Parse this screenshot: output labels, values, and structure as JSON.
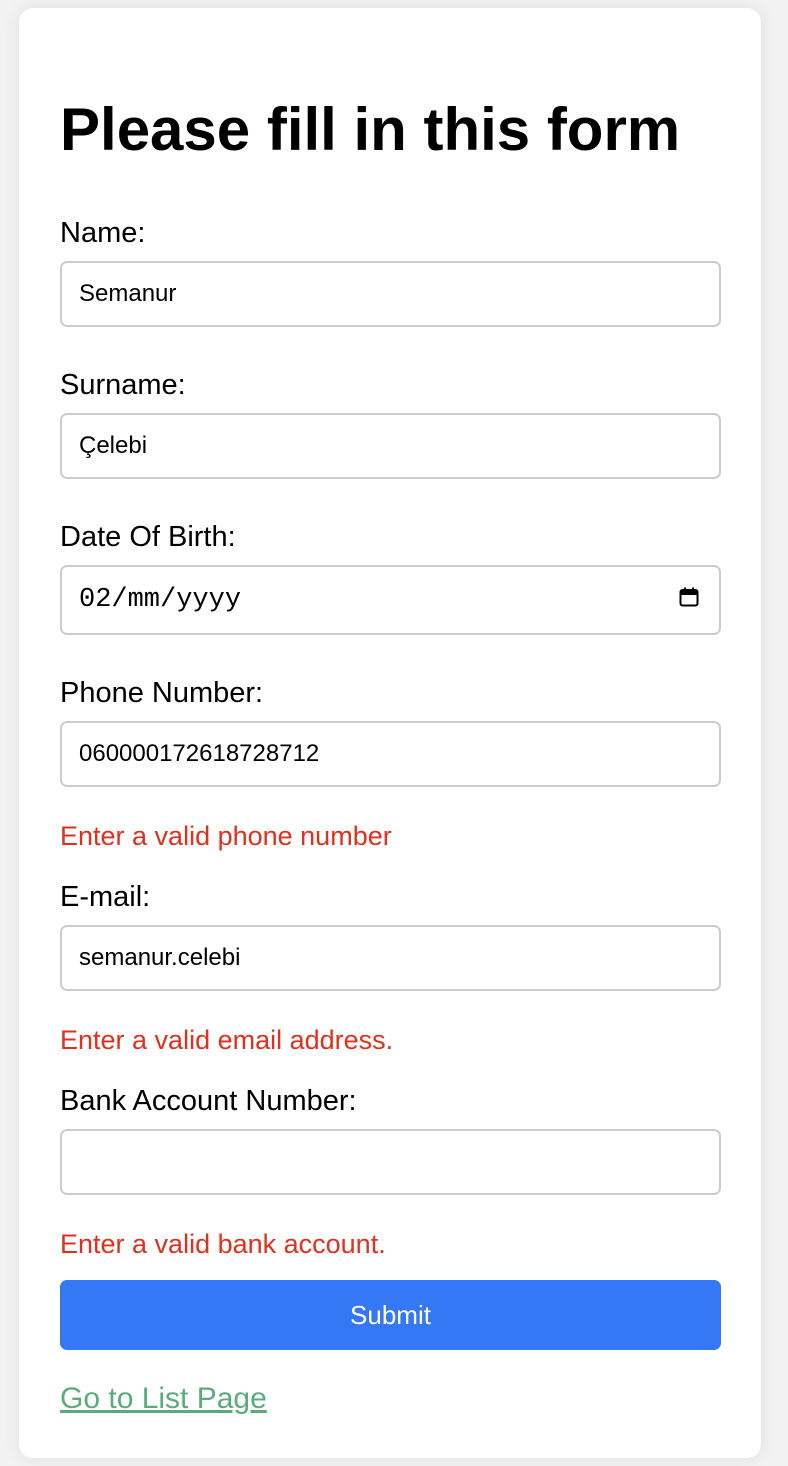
{
  "form": {
    "title": "Please fill in this form",
    "fields": {
      "name": {
        "label": "Name:",
        "value": "Semanur"
      },
      "surname": {
        "label": "Surname:",
        "value": "Çelebi"
      },
      "date_of_birth": {
        "label": "Date Of Birth:",
        "value": "02/mm/yyyy",
        "icon": "calendar-icon"
      },
      "phone": {
        "label": "Phone Number:",
        "value": "060000172618728712",
        "error": "Enter a valid phone number"
      },
      "email": {
        "label": "E-mail:",
        "value": "semanur.celebi",
        "error": "Enter a valid email address."
      },
      "bank": {
        "label": "Bank Account Number:",
        "value": "",
        "error": "Enter a valid bank account."
      }
    },
    "submit_label": "Submit",
    "list_link": "Go to List Page"
  },
  "colors": {
    "submit_bg": "#3478f6",
    "error_text": "#e0301e",
    "link_text": "#5aad7a"
  }
}
